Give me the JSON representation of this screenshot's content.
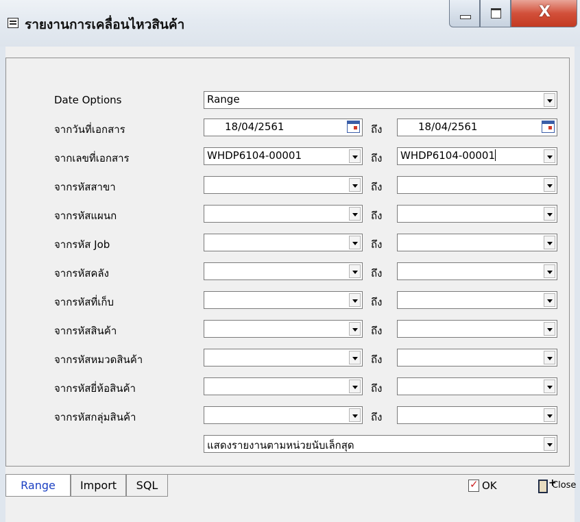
{
  "window": {
    "title": "รายงานการเคลื่อนไหวสินค้า",
    "controls": {
      "close_glyph": "X"
    }
  },
  "form": {
    "date_options": {
      "label": "Date Options",
      "value": "Range"
    },
    "to_label": "ถึง",
    "doc_date": {
      "label": "จากวันที่เอกสาร",
      "from": "18/04/2561",
      "to": "18/04/2561"
    },
    "doc_no": {
      "label": "จากเลขที่เอกสาร",
      "from": "WHDP6104-00001",
      "to": "WHDP6104-00001"
    },
    "rows": [
      {
        "label": "จากรหัสสาขา",
        "from": "",
        "to": ""
      },
      {
        "label": "จากรหัสแผนก",
        "from": "",
        "to": ""
      },
      {
        "label": "จากรหัส Job",
        "from": "",
        "to": ""
      },
      {
        "label": "จากรหัสคลัง",
        "from": "",
        "to": ""
      },
      {
        "label": "จากรหัสที่เก็บ",
        "from": "",
        "to": ""
      },
      {
        "label": "จากรหัสสินค้า",
        "from": "",
        "to": ""
      },
      {
        "label": "จากรหัสหมวดสินค้า",
        "from": "",
        "to": ""
      },
      {
        "label": "จากรหัสยี่ห้อสินค้า",
        "from": "",
        "to": ""
      },
      {
        "label": "จากรหัสกลุ่มสินค้า",
        "from": "",
        "to": ""
      }
    ],
    "unit_option": "แสดงรายงานตามหน่วยนับเล็กสุด"
  },
  "tabs": [
    {
      "label": "Range",
      "active": true
    },
    {
      "label": "Import",
      "active": false
    },
    {
      "label": "SQL",
      "active": false
    }
  ],
  "buttons": {
    "ok": "OK",
    "close": "Close"
  }
}
